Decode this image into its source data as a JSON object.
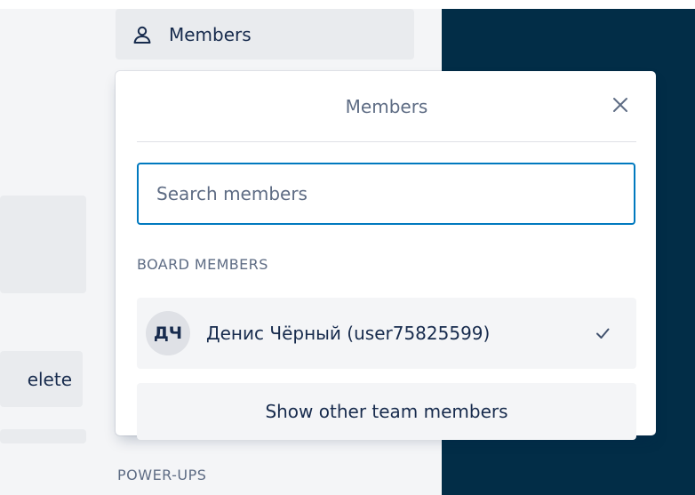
{
  "sidebar": {
    "members_button": {
      "label": "Members",
      "icon": "person-icon"
    },
    "delete_button": {
      "label": "elete"
    },
    "powerups_label": "POWER-UPS"
  },
  "popover": {
    "title": "Members",
    "close_icon": "close-icon",
    "search": {
      "placeholder": "Search members",
      "value": ""
    },
    "section_label": "BOARD MEMBERS",
    "members": [
      {
        "initials": "ДЧ",
        "name": "Денис Чёрный (user75825599)",
        "selected": true
      }
    ],
    "show_other_label": "Show other team members"
  },
  "colors": {
    "accent": "#0079bf",
    "dark_panel": "#022d47",
    "button_bg": "#f4f5f7",
    "text": "#172b4d",
    "muted_text": "#5e6c84"
  }
}
